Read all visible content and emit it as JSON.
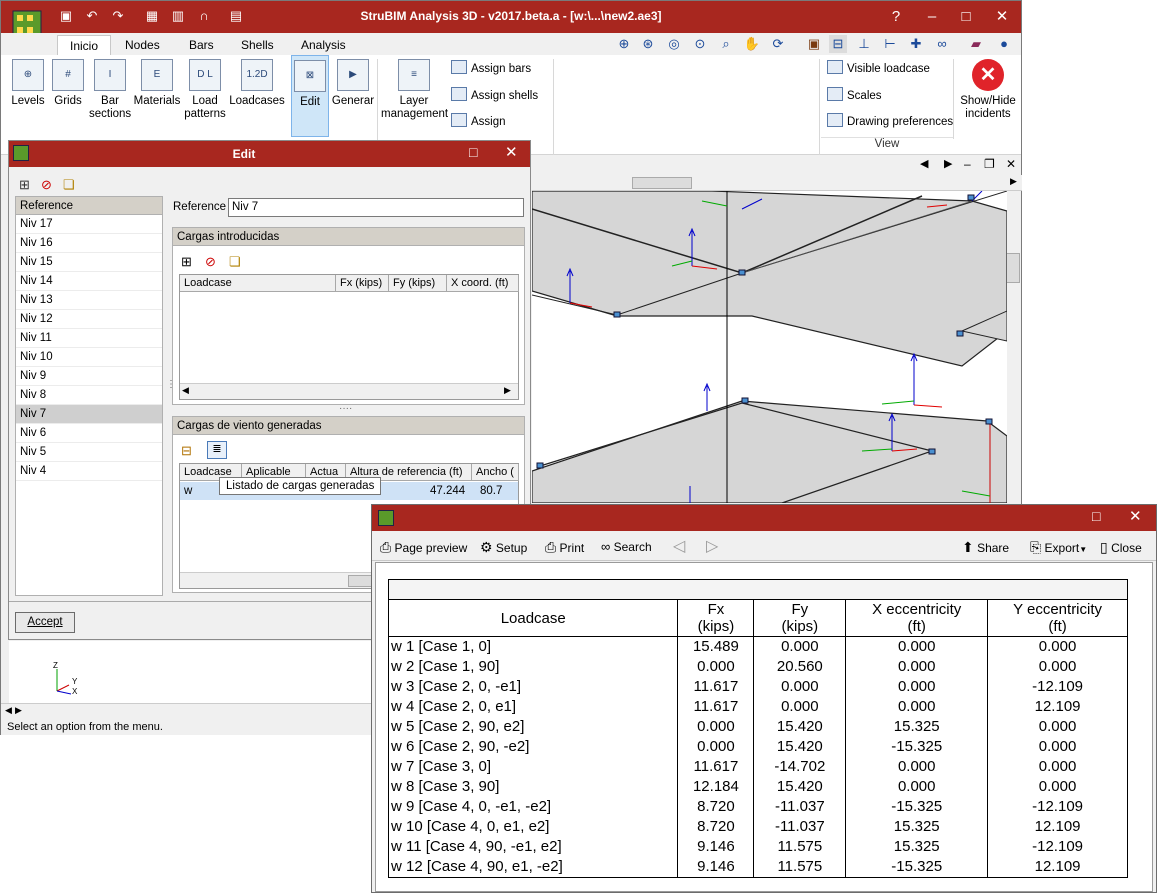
{
  "app": {
    "title": "StruBIM Analysis 3D - v2017.beta.a - [w:\\...\\new2.ae3]",
    "tabs": [
      "Inicio",
      "Nodes",
      "Bars",
      "Shells",
      "Analysis"
    ],
    "ribbon": {
      "buttons": [
        "Levels",
        "Grids",
        "Bar sections",
        "Materials",
        "Load patterns",
        "Loadcases",
        "Edit",
        "Generar",
        "Layer management"
      ],
      "small_buttons": [
        "Assign bars",
        "Assign shells",
        "Assign"
      ],
      "view_buttons": [
        "Visible loadcase",
        "Scales",
        "Drawing preferences"
      ],
      "show_hide": "Show/Hide incidents",
      "view_group": "View"
    },
    "status": "Select an option from the menu.",
    "axis": {
      "z": "Z",
      "y": "Y",
      "x": "X"
    }
  },
  "edit_dialog": {
    "title": "Edit",
    "reference_header": "Reference",
    "levels": [
      "Niv 17",
      "Niv 16",
      "Niv 15",
      "Niv 14",
      "Niv 13",
      "Niv 12",
      "Niv 11",
      "Niv 10",
      "Niv 9",
      "Niv 8",
      "Niv 7",
      "Niv 6",
      "Niv 5",
      "Niv 4"
    ],
    "selected_level": "Niv 7",
    "reference_label": "Reference",
    "reference_value": "Niv 7",
    "group1_title": "Cargas introducidas",
    "group1_columns": [
      "Loadcase",
      "Fx (kips)",
      "Fy (kips)",
      "X coord. (ft)"
    ],
    "group2_title": "Cargas de viento generadas",
    "group2_columns": [
      "Loadcase",
      "Aplicable",
      "Actua",
      "Altura de referencia (ft)",
      "Ancho ("
    ],
    "group2_row": {
      "loadcase": "w",
      "altura": "47.244",
      "ancho": "80.7"
    },
    "tooltip": "Listado de cargas generadas",
    "accept": "Accept"
  },
  "report": {
    "toolbar": {
      "page_preview": "Page preview",
      "setup": "Setup",
      "print": "Print",
      "search": "Search",
      "share": "Share",
      "export": "Export",
      "close": "Close"
    },
    "headers": {
      "loadcase": "Loadcase",
      "fx": "Fx",
      "fx_unit": "(kips)",
      "fy": "Fy",
      "fy_unit": "(kips)",
      "xe": "X eccentricity",
      "xe_unit": "(ft)",
      "ye": "Y eccentricity",
      "ye_unit": "(ft)"
    },
    "rows": [
      [
        "w 1 [Case 1, 0]",
        "15.489",
        "0.000",
        "0.000",
        "0.000"
      ],
      [
        "w 2 [Case 1, 90]",
        "0.000",
        "20.560",
        "0.000",
        "0.000"
      ],
      [
        "w 3 [Case 2, 0, -e1]",
        "11.617",
        "0.000",
        "0.000",
        "-12.109"
      ],
      [
        "w 4 [Case 2, 0, e1]",
        "11.617",
        "0.000",
        "0.000",
        "12.109"
      ],
      [
        "w 5 [Case 2, 90, e2]",
        "0.000",
        "15.420",
        "15.325",
        "0.000"
      ],
      [
        "w 6 [Case 2, 90, -e2]",
        "0.000",
        "15.420",
        "-15.325",
        "0.000"
      ],
      [
        "w 7 [Case 3, 0]",
        "11.617",
        "-14.702",
        "0.000",
        "0.000"
      ],
      [
        "w 8 [Case 3, 90]",
        "12.184",
        "15.420",
        "0.000",
        "0.000"
      ],
      [
        "w 9 [Case 4, 0, -e1, -e2]",
        "8.720",
        "-11.037",
        "-15.325",
        "-12.109"
      ],
      [
        "w 10 [Case 4, 0, e1, e2]",
        "8.720",
        "-11.037",
        "15.325",
        "12.109"
      ],
      [
        "w 11 [Case 4, 90, -e1, e2]",
        "9.146",
        "11.575",
        "15.325",
        "-12.109"
      ],
      [
        "w 12 [Case 4, 90, e1, -e2]",
        "9.146",
        "11.575",
        "-15.325",
        "12.109"
      ]
    ]
  },
  "colors": {
    "titlebar": "#a8271f",
    "selection": "#cfcfcf",
    "edit_active": "#cfe6f8"
  }
}
